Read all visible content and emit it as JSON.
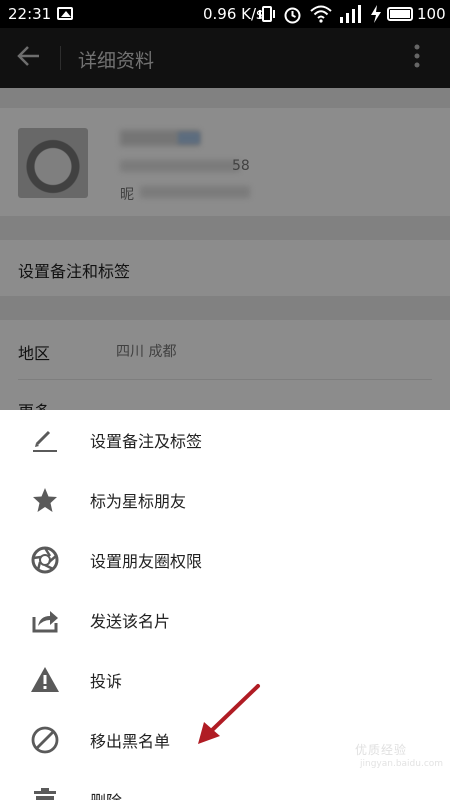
{
  "status_bar": {
    "time": "22:31",
    "net_speed": "0.96 K/s",
    "battery": "100",
    "icons": [
      "image-icon",
      "vibrate-icon",
      "alarm-icon",
      "wifi-icon",
      "signal-icon",
      "charging-icon",
      "battery-icon"
    ]
  },
  "app_bar": {
    "back_icon": "arrow-left-icon",
    "title": "详细资料",
    "more_icon": "more-vertical-icon"
  },
  "profile": {
    "id_suffix": "58",
    "nickname_prefix": "昵"
  },
  "rows": {
    "remark": "设置备注和标签",
    "region_label": "地区",
    "region_value": "四川 成都",
    "more_label": "更多"
  },
  "sheet": {
    "items": [
      {
        "label": "设置备注及标签",
        "icon": "pencil-icon"
      },
      {
        "label": "标为星标朋友",
        "icon": "star-icon"
      },
      {
        "label": "设置朋友圈权限",
        "icon": "aperture-icon"
      },
      {
        "label": "发送该名片",
        "icon": "share-icon"
      },
      {
        "label": "投诉",
        "icon": "warning-icon"
      },
      {
        "label": "移出黑名单",
        "icon": "block-icon"
      },
      {
        "label": "删除",
        "icon": "trash-icon"
      }
    ]
  },
  "colors": {
    "icon_gray": "#5a5a5a",
    "arrow_red": "#b01c24",
    "app_bar": "#1f1f1f"
  },
  "watermark": {
    "line1": "优质经验",
    "line2": "jingyan.baidu.com"
  }
}
